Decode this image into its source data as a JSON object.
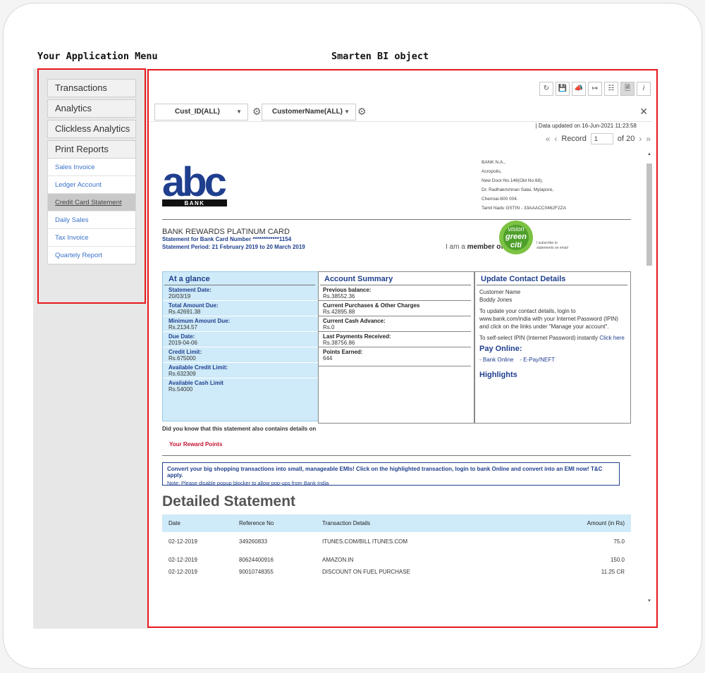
{
  "captions": {
    "left": "Your Application Menu",
    "right": "Smarten BI object"
  },
  "menu": {
    "sections": [
      "Transactions",
      "Analytics",
      "Clickless Analytics",
      "Print Reports"
    ],
    "items": [
      "Sales Invoice",
      "Ledger Account",
      "Credit Card Statement",
      "Daily Sales",
      "Tax Invoice",
      "Quartely Report"
    ],
    "selected": "Credit Card Statement"
  },
  "toolbar": {
    "icons": [
      "refresh-icon",
      "save-icon",
      "broadcast-icon",
      "export-icon",
      "filter-list-icon",
      "document-icon",
      "info-icon"
    ]
  },
  "filters": {
    "cust_id": "Cust_ID(ALL)",
    "customer_name": "CustomerName(ALL)"
  },
  "status": {
    "updated": "| Data updated on 16-Jun-2021 11:23:58"
  },
  "pager": {
    "label": "Record",
    "current": "1",
    "total": "of 20"
  },
  "statement": {
    "logo_text": "abc",
    "logo_bank": "BANK",
    "address": [
      "BANK N.A.,",
      "Acropolis,",
      "New Door No.148(Old No.68),",
      "Dr. Radhakrishnan Salai, Mylapore,",
      "Chennai-600 004.",
      "Tamil Nadu GSTIN - 33AAACC0462F2ZA"
    ],
    "card_name": "BANK REWARDS PLATINUM CARD",
    "card_number": "Statement for Bank Card Number ************1154",
    "period": "Statement Period: 21 February 2019 to 20 March 2019",
    "member_prefix": "I am a",
    "member_word": "member of",
    "vision_words": [
      "vision",
      "green",
      "citi"
    ],
    "subscribe": [
      "I subscribe to",
      "statements on email"
    ],
    "glance_title": "At a glance",
    "glance": [
      {
        "label": "Statement Date:",
        "value": "20/03/19"
      },
      {
        "label": "Total Amount Due:",
        "value": "Rs.42691.38"
      },
      {
        "label": "Minimum Amount Due:",
        "value": "Rs.2134.57"
      },
      {
        "label": "Due Date:",
        "value": "2019-04-06"
      },
      {
        "label": "Credit Limit:",
        "value": "Rs.675000"
      },
      {
        "label": "Available Credit Limit:",
        "value": "Rs.632309"
      },
      {
        "label": "Available Cash Limit",
        "value": "Rs.54000"
      }
    ],
    "summary_title": "Account Summary",
    "summary": [
      {
        "label": "Previous balance:",
        "value": "Rs.38552.36"
      },
      {
        "label": "Current Purchases & Other Charges",
        "value": "Rs.42895.88"
      },
      {
        "label": "Current Cash Advance:",
        "value": "Rs.0"
      },
      {
        "label": "Last Payments Received:",
        "value": "Rs.38756.86"
      },
      {
        "label": "Points Earned:",
        "value": "644"
      }
    ],
    "contact_title": "Update Contact Details",
    "contact_name_label": "Customer Name",
    "contact_name": "Boddy Jones",
    "contact_text": "To update your contact details, login to www.bank.com/india with your Internet Password (IPIN) and click on the links under \"Manage your account\".",
    "ipin_text": "To self-select IPIN (Internet Password) instantly",
    "ipin_link": "Click here",
    "pay_title": "Pay Online:",
    "pay_bank": "- Bank Online",
    "pay_epay": "- E-Pay/NEFT",
    "highlights": "Highlights",
    "did_you_know": "Did you know that this statement also contains details on",
    "reward_points": "Your Reward Points",
    "emi_main": "Convert your big shopping transactions into small, manageable EMIs! Click on the highlighted transaction, login to bank Online and convert into an EMI now! T&C apply.",
    "emi_note": "Note: Please disable popup blocker to allow pop-ups from Bank India",
    "detailed_title": "Detailed Statement",
    "columns": [
      "Date",
      "Reference No",
      "Transaction Details",
      "Amount (in Rs)"
    ],
    "rows": [
      [
        "02-12-2019",
        "349260833",
        "ITUNES.COM/BILL ITUNES.COM",
        "75.0"
      ],
      [
        "02-12-2019",
        "80624400916",
        "AMAZON.IN",
        "150.0"
      ],
      [
        "02-12-2019",
        "90010748355",
        "DISCOUNT ON FUEL PURCHASE",
        "11.25 CR"
      ]
    ]
  },
  "colors": {
    "accent_red": "#e8171b",
    "bank_blue": "#1f3f8e",
    "glance_bg": "#cfeaf8",
    "link_blue": "#3a73c8"
  }
}
